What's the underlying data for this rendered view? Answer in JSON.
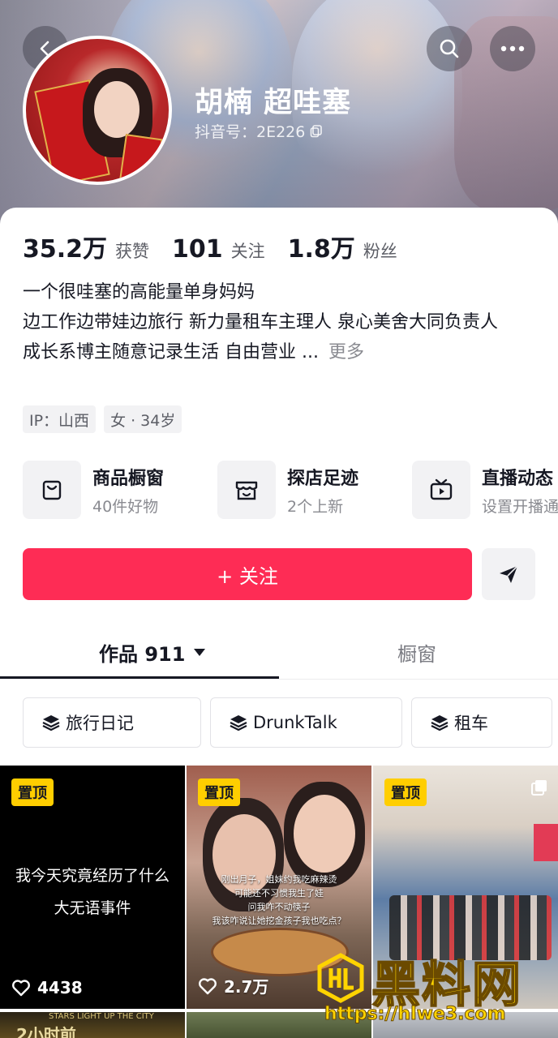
{
  "profile": {
    "name": "胡楠 超哇塞",
    "douyin_id": "抖音号：2E226"
  },
  "stats": [
    {
      "value": "35.2万",
      "label": "获赞"
    },
    {
      "value": "101",
      "label": "关注"
    },
    {
      "value": "1.8万",
      "label": "粉丝"
    }
  ],
  "bio": {
    "line1": "一个很哇塞的高能量单身妈妈",
    "line2": "边工作边带娃边旅行 新力量租车主理人 泉心美舍大同负责人",
    "line3": "成长系博主随意记录生活 自由营业 ...",
    "more": "更多"
  },
  "tags": [
    "IP：山西",
    "女 · 34岁"
  ],
  "features": [
    {
      "title": "商品橱窗",
      "sub": "40件好物",
      "icon": "bag-icon"
    },
    {
      "title": "探店足迹",
      "sub": "2个上新",
      "icon": "store-icon"
    },
    {
      "title": "直播动态",
      "sub": "设置开播通",
      "icon": "tv-icon"
    }
  ],
  "actions": {
    "follow_label": "+ 关注"
  },
  "tabs": {
    "works": "作品 911",
    "window": "橱窗"
  },
  "collections": [
    "旅行日记",
    "DrunkTalk",
    "租车"
  ],
  "videos": [
    {
      "pinned": "置顶",
      "caption_line1": "我今天究竟经历了什么",
      "caption_line2": "大无语事件",
      "likes": "4438"
    },
    {
      "pinned": "置顶",
      "sub1": "刚出月子，姐妹约我吃麻辣烫",
      "sub2": "可能还不习惯我生了娃",
      "sub3": "问我咋不动筷子",
      "sub4": "我该咋说让她挖金孩子我也吃点？",
      "likes": "2.7万"
    },
    {
      "pinned": "置顶",
      "likes": ""
    }
  ],
  "row2": {
    "text1": "2小时前",
    "small": "STARS LIGHT UP THE CITY"
  },
  "watermark": {
    "text": "黑料网",
    "url": "https://hlwe3.com"
  },
  "colors": {
    "accent": "#fe2c55",
    "pin": "#ffce00",
    "watermark": "#ffd400"
  }
}
